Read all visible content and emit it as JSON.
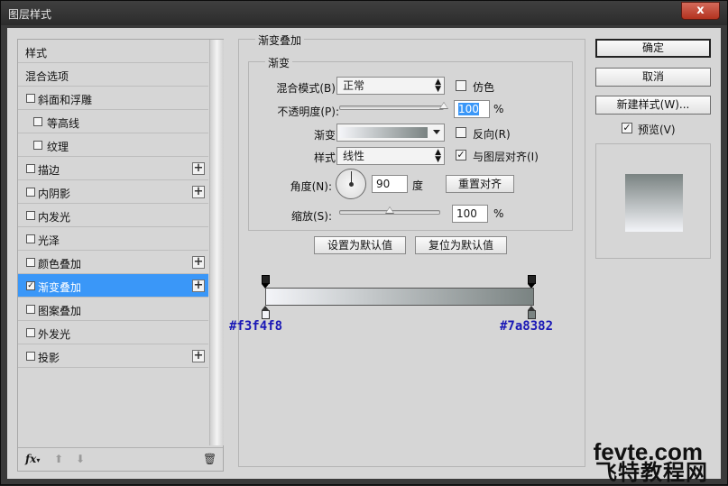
{
  "window": {
    "title": "图层样式",
    "close_glyph": "x"
  },
  "sidebar": {
    "items": [
      {
        "label": "样式",
        "checkbox": false,
        "checked": false,
        "plus": false,
        "indent": false,
        "selected": false
      },
      {
        "label": "混合选项",
        "checkbox": false,
        "checked": false,
        "plus": false,
        "indent": false,
        "selected": false
      },
      {
        "label": "斜面和浮雕",
        "checkbox": true,
        "checked": false,
        "plus": false,
        "indent": false,
        "selected": false
      },
      {
        "label": "等高线",
        "checkbox": true,
        "checked": false,
        "plus": false,
        "indent": true,
        "selected": false
      },
      {
        "label": "纹理",
        "checkbox": true,
        "checked": false,
        "plus": false,
        "indent": true,
        "selected": false
      },
      {
        "label": "描边",
        "checkbox": true,
        "checked": false,
        "plus": true,
        "indent": false,
        "selected": false
      },
      {
        "label": "内阴影",
        "checkbox": true,
        "checked": false,
        "plus": true,
        "indent": false,
        "selected": false
      },
      {
        "label": "内发光",
        "checkbox": true,
        "checked": false,
        "plus": false,
        "indent": false,
        "selected": false
      },
      {
        "label": "光泽",
        "checkbox": true,
        "checked": false,
        "plus": false,
        "indent": false,
        "selected": false
      },
      {
        "label": "颜色叠加",
        "checkbox": true,
        "checked": false,
        "plus": true,
        "indent": false,
        "selected": false
      },
      {
        "label": "渐变叠加",
        "checkbox": true,
        "checked": true,
        "plus": true,
        "indent": false,
        "selected": true
      },
      {
        "label": "图案叠加",
        "checkbox": true,
        "checked": false,
        "plus": false,
        "indent": false,
        "selected": false
      },
      {
        "label": "外发光",
        "checkbox": true,
        "checked": false,
        "plus": false,
        "indent": false,
        "selected": false
      },
      {
        "label": "投影",
        "checkbox": true,
        "checked": false,
        "plus": true,
        "indent": false,
        "selected": false
      }
    ],
    "footer": {
      "fx": "fx",
      "fx_arrow": "▾",
      "up": "⬆",
      "down": "⬇",
      "trash": "🗑"
    }
  },
  "panel": {
    "section_title": "渐变叠加",
    "group_title": "渐变",
    "blend_mode_label": "混合模式(B):",
    "blend_mode_value": "正常",
    "dither_label": "仿色",
    "opacity_label": "不透明度(P):",
    "opacity_value": "100",
    "opacity_level": 1.0,
    "percent": "%",
    "gradient_label": "渐变:",
    "reverse_label": "反向(R)",
    "style_label": "样式:",
    "style_value": "线性",
    "align_label": "与图层对齐(I)",
    "angle_label": "角度(N):",
    "angle_value": "90",
    "degree": "度",
    "reset_align_label": "重置对齐",
    "scale_label": "缩放(S):",
    "scale_value": "100",
    "scale_level": 0.5,
    "set_default_label": "设置为默认值",
    "reset_default_label": "复位为默认值",
    "updown_glyph": "▲\n▼",
    "check_glyph": "✓"
  },
  "gradient": {
    "start_color": "#f3f4f8",
    "end_color": "#7a8382",
    "start_hex": "#f3f4f8",
    "end_hex": "#7a8382"
  },
  "actions": {
    "ok": "确定",
    "cancel": "取消",
    "new_style": "新建样式(W)...",
    "preview_label": "预览(V)"
  },
  "watermark": {
    "line1": "fevte.com",
    "line2": "飞特教程网"
  }
}
